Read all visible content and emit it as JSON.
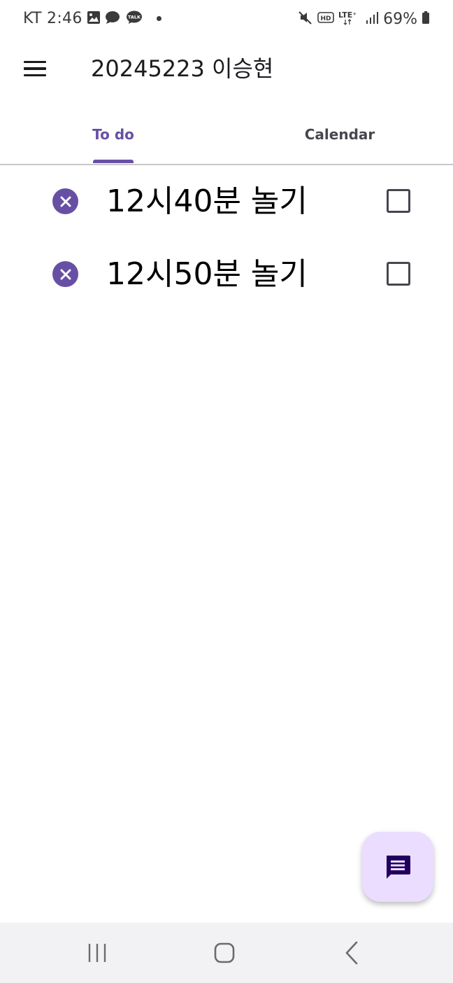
{
  "status_bar": {
    "time": "KT 2:46",
    "battery": "69%",
    "icons": [
      "gallery-icon",
      "chat-bubble-icon",
      "kakaotalk-icon",
      "mute-icon",
      "hd-icon",
      "lte-icon",
      "signal-icon",
      "battery-icon"
    ]
  },
  "app_bar": {
    "title": "20245223 이승현"
  },
  "tabs": [
    {
      "label": "To do",
      "selected": true
    },
    {
      "label": "Calendar",
      "selected": false
    }
  ],
  "todos": [
    {
      "text": "12시40분 놀기",
      "checked": false
    },
    {
      "text": "12시50분 놀기",
      "checked": false
    }
  ],
  "colors": {
    "accent": "#6750a4",
    "fab_bg": "#eaddff",
    "nav_bg": "#f2f2f4"
  }
}
